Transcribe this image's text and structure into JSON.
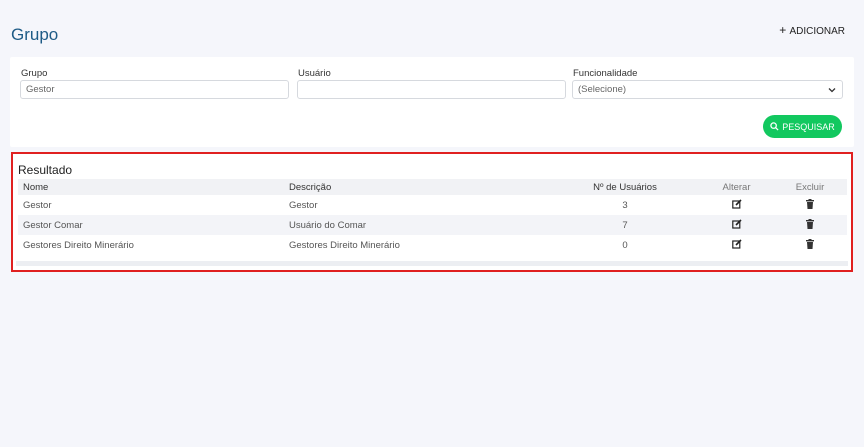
{
  "header": {
    "title": "Grupo",
    "add_label": "ADICIONAR"
  },
  "filters": {
    "grupo": {
      "label": "Grupo",
      "value": "Gestor"
    },
    "usuario": {
      "label": "Usuário",
      "value": ""
    },
    "funcionalidade": {
      "label": "Funcionalidade",
      "selected": "(Selecione)"
    },
    "search_label": "PESQUISAR"
  },
  "result": {
    "title": "Resultado",
    "columns": [
      "Nome",
      "Descrição",
      "Nº de Usuários",
      "Alterar",
      "Excluir"
    ],
    "rows": [
      {
        "nome": "Gestor",
        "descricao": "Gestor",
        "usuarios": "3"
      },
      {
        "nome": "Gestor Comar",
        "descricao": "Usuário do Comar",
        "usuarios": "7"
      },
      {
        "nome": "Gestores Direito Minerário",
        "descricao": "Gestores Direito Minerário",
        "usuarios": "0"
      }
    ]
  },
  "colors": {
    "accent": "#1e5b86",
    "search_button": "#12c85f",
    "highlight_border": "#e02020"
  },
  "icons": {
    "edit": "edit-icon",
    "delete": "trash-icon",
    "search": "search-icon",
    "add": "plus-icon"
  }
}
